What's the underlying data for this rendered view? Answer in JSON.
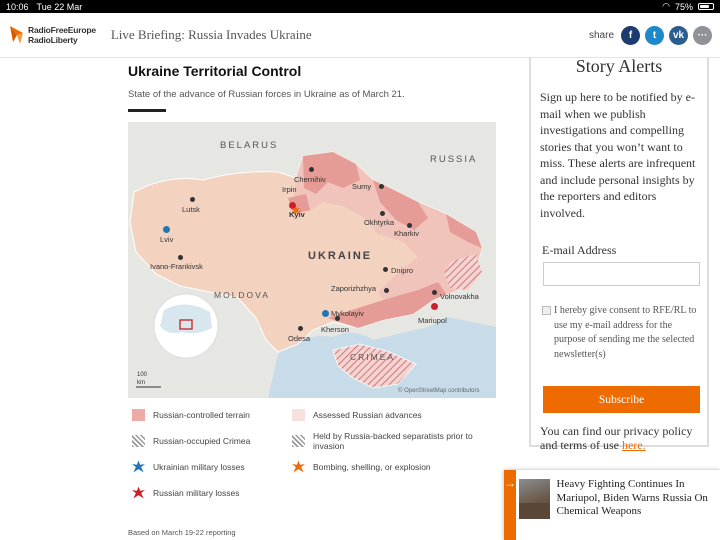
{
  "status_bar": {
    "time": "10:06",
    "date": "Tue 22 Mar",
    "battery": "75%",
    "battery_level": 0.75
  },
  "header": {
    "logo_line1": "RadioFreeEurope",
    "logo_line2": "RadioLiberty",
    "briefing_title": "Live Briefing: Russia Invades Ukraine",
    "share_label": "share",
    "share_buttons": [
      {
        "icon": "facebook-icon",
        "glyph": "f",
        "color": "#1a3c6e"
      },
      {
        "icon": "twitter-icon",
        "glyph": "t",
        "color": "#1e88c9"
      },
      {
        "icon": "vk-icon",
        "glyph": "vk",
        "color": "#2c5d8f"
      },
      {
        "icon": "more-icon",
        "glyph": "···",
        "color": "#8f9296"
      }
    ]
  },
  "article": {
    "title": "Ukraine Territorial Control",
    "subtitle": "State of the advance of Russian forces in Ukraine as of March 21.",
    "footnote": "Based on March 19-22 reporting"
  },
  "map": {
    "labels": {
      "belarus": "BELARUS",
      "russia": "RUSSIA",
      "ukraine": "UKRAINE",
      "moldova": "MOLDOVA",
      "crimea": "CRIMEA",
      "scale": "100",
      "scale_unit": "km",
      "attribution": "© OpenStreetMap contributors"
    },
    "cities": [
      "Chernihiv",
      "Irpin",
      "Kyiv",
      "Sumy",
      "Lutsk",
      "Okhtyrka",
      "Kharkiv",
      "Lviv",
      "Ivano-Frankivsk",
      "Dnipro",
      "Zaporizhzhya",
      "Volnovakha",
      "Mariupol",
      "Mykolayiv",
      "Kherson",
      "Odesa"
    ]
  },
  "legend": [
    {
      "label": "Russian-controlled terrain",
      "icon": "russian-controlled-swatch",
      "color": "#eeaaa6"
    },
    {
      "label": "Assessed Russian advances",
      "icon": "advances-swatch",
      "color": "#f8e0df"
    },
    {
      "label": "Russian-occupied Crimea",
      "icon": "crimea-hatch-swatch",
      "color": "#999999"
    },
    {
      "label": "Held by Russia-backed separatists prior to invasion",
      "icon": "separatist-hatch-swatch",
      "color": "#999999"
    },
    {
      "label": "Ukrainian military losses",
      "icon": "ukrainian-loss-icon",
      "color": "#1f77b4"
    },
    {
      "label": "Bombing, shelling, or explosion",
      "icon": "explosion-icon",
      "color": "#ee6b00"
    },
    {
      "label": "Russian military losses",
      "icon": "russian-loss-icon",
      "color": "#cc2027"
    }
  ],
  "sidebar": {
    "title": "Story Alerts",
    "text": "Sign up here to be notified by e-mail when we publish investigations and compelling stories that you won’t want to miss. These alerts are infrequent and include personal insights by the reporters and editors involved.",
    "email_label": "E-mail Address",
    "email_value": "",
    "consent": "I hereby give consent to RFE/RL to use my e-mail address for the purpose of sending me the selected newsletter(s)",
    "button": "Subscribe",
    "footer_text": "You can find our privacy policy and terms of use ",
    "footer_link": "here."
  },
  "card": {
    "arrow": "→",
    "headline": "Heavy Fighting Continues In Mariupol, Biden Warns Russia On Chemical Weapons"
  },
  "colors": {
    "accent": "#ee6b00"
  }
}
